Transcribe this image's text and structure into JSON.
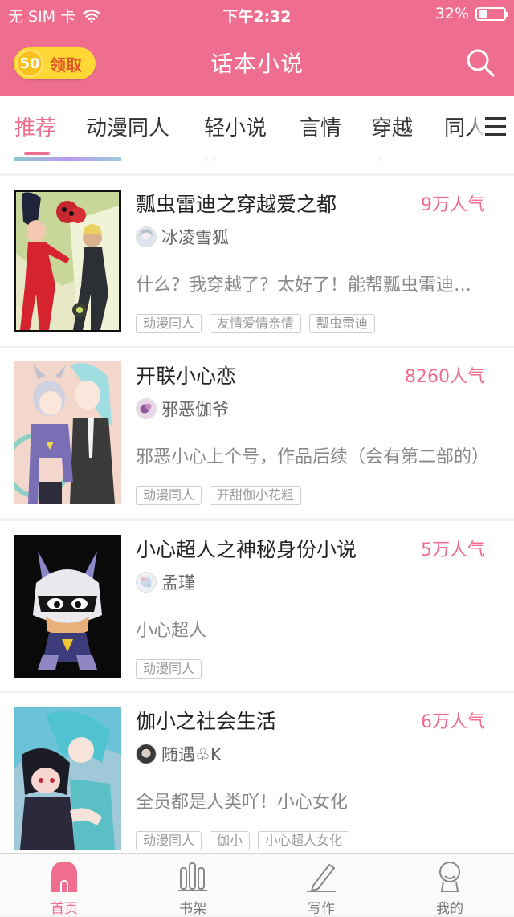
{
  "status_bar": {
    "carrier": "无 SIM 卡",
    "time": "下午2:32",
    "battery": "32%",
    "battery_level": 0.32
  },
  "header": {
    "reward_count": "50",
    "reward_label": "领取",
    "title": "话本小说",
    "search_icon": "search-icon"
  },
  "tabs": [
    {
      "label": "推荐",
      "active": true
    },
    {
      "label": "动漫同人"
    },
    {
      "label": "轻小说"
    },
    {
      "label": "言情"
    },
    {
      "label": "穿越"
    },
    {
      "label": "同人"
    }
  ],
  "stories": [
    {
      "title": "瓢虫雷迪之穿越爱之都",
      "popularity": "9万人气",
      "author": "冰凌雪狐",
      "description": "什么？我穿越了？太好了！能帮瓢虫雷迪打败蝴蝶魔了",
      "tags": [
        "动漫同人",
        "友情爱情亲情",
        "瓢虫雷迪"
      ]
    },
    {
      "title": "开联小心恋",
      "popularity": "8260人气",
      "author": "邪恶伽爷",
      "description": "邪恶小心上个号，作品后续（会有第二部的）",
      "tags": [
        "动漫同人",
        "开甜伽小花粗"
      ]
    },
    {
      "title": "小心超人之神秘身份小说",
      "popularity": "5万人气",
      "author": "孟瑾",
      "description": "小心超人",
      "tags": [
        "动漫同人"
      ]
    },
    {
      "title": "伽小之社会生活",
      "popularity": "6万人气",
      "author": "随遇♧K",
      "description": "全员都是人类吖！小心女化",
      "tags": [
        "动漫同人",
        "伽小",
        "小心超人女化"
      ]
    }
  ],
  "bottom_nav": [
    {
      "label": "首页",
      "icon": "home-icon",
      "active": true
    },
    {
      "label": "书架",
      "icon": "bookshelf-icon"
    },
    {
      "label": "写作",
      "icon": "pencil-icon"
    },
    {
      "label": "我的",
      "icon": "profile-icon"
    }
  ],
  "colors": {
    "brand": "#ef6d8e",
    "coin": "#ffd835"
  }
}
